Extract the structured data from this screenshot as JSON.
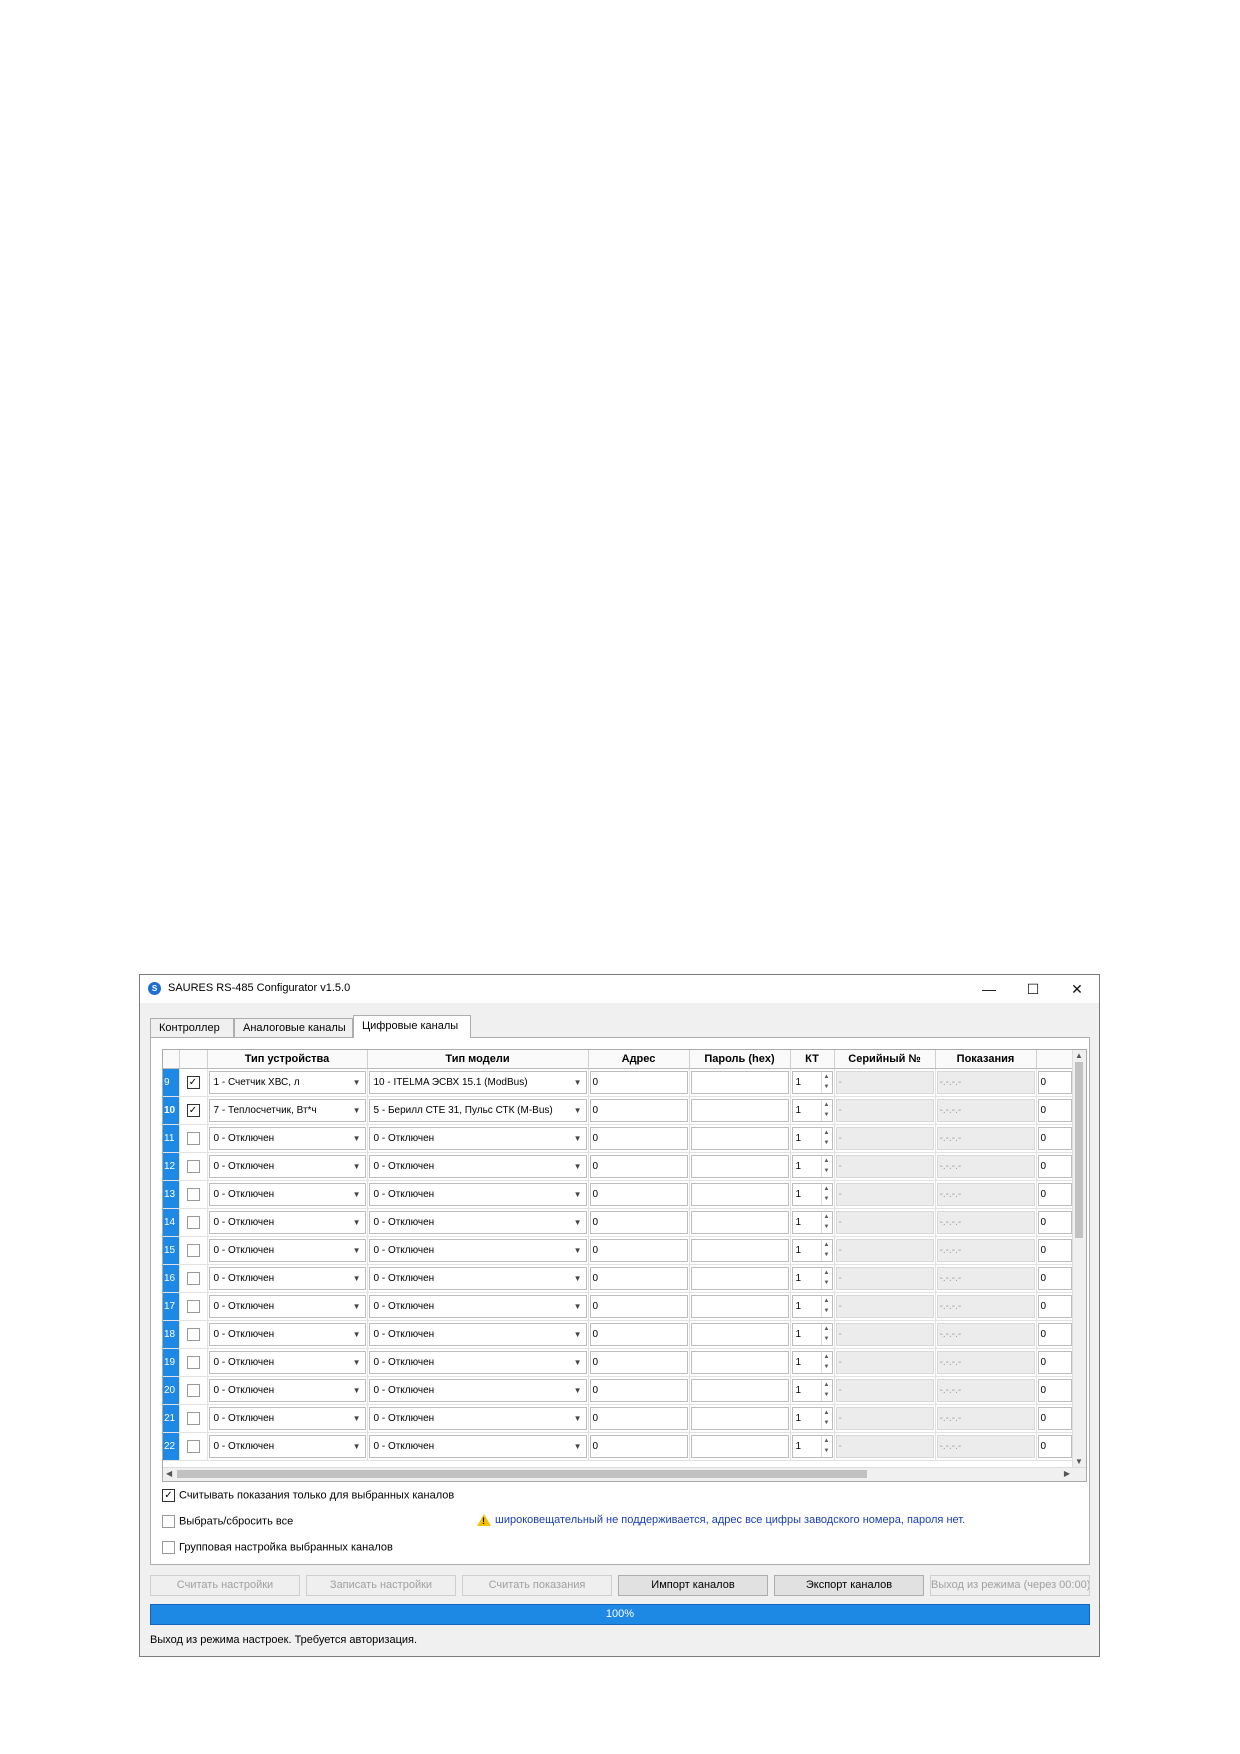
{
  "window": {
    "title": "SAURES RS-485 Configurator v1.5.0",
    "icon": "app-icon"
  },
  "window_controls": {
    "minimize": "—",
    "maximize": "☐",
    "close": "✕"
  },
  "tabs": [
    {
      "label": "Контроллер",
      "active": false
    },
    {
      "label": "Аналоговые каналы",
      "active": false
    },
    {
      "label": "Цифровые каналы",
      "active": true
    }
  ],
  "table": {
    "headers": [
      "",
      "",
      "Тип устройства",
      "Тип модели",
      "Адрес",
      "Пароль (hex)",
      "КТ",
      "Серийный №",
      "Показания",
      ""
    ],
    "rows": [
      {
        "num": "9",
        "checked": true,
        "device": "1 - Счетчик ХВС, л",
        "model": "10 - ITELMA ЭСВХ 15.1 (ModBus)",
        "address": "0",
        "password": "",
        "kt": "1",
        "serial": "-",
        "reading": "-.-.-.-",
        "extra": "0"
      },
      {
        "num": "10",
        "checked": true,
        "device": "7 - Теплосчетчик, Вт*ч",
        "model": "5 - Берилл СТЕ 31, Пульс СТК (M-Bus)",
        "address": "0",
        "password": "",
        "kt": "1",
        "serial": "-",
        "reading": "-.-.-.-",
        "extra": "0"
      },
      {
        "num": "11",
        "checked": false,
        "device": "0 - Отключен",
        "model": "0 - Отключен",
        "address": "0",
        "password": "",
        "kt": "1",
        "serial": "-",
        "reading": "-.-.-.-",
        "extra": "0"
      },
      {
        "num": "12",
        "checked": false,
        "device": "0 - Отключен",
        "model": "0 - Отключен",
        "address": "0",
        "password": "",
        "kt": "1",
        "serial": "-",
        "reading": "-.-.-.-",
        "extra": "0"
      },
      {
        "num": "13",
        "checked": false,
        "device": "0 - Отключен",
        "model": "0 - Отключен",
        "address": "0",
        "password": "",
        "kt": "1",
        "serial": "-",
        "reading": "-.-.-.-",
        "extra": "0"
      },
      {
        "num": "14",
        "checked": false,
        "device": "0 - Отключен",
        "model": "0 - Отключен",
        "address": "0",
        "password": "",
        "kt": "1",
        "serial": "-",
        "reading": "-.-.-.-",
        "extra": "0"
      },
      {
        "num": "15",
        "checked": false,
        "device": "0 - Отключен",
        "model": "0 - Отключен",
        "address": "0",
        "password": "",
        "kt": "1",
        "serial": "-",
        "reading": "-.-.-.-",
        "extra": "0"
      },
      {
        "num": "16",
        "checked": false,
        "device": "0 - Отключен",
        "model": "0 - Отключен",
        "address": "0",
        "password": "",
        "kt": "1",
        "serial": "-",
        "reading": "-.-.-.-",
        "extra": "0"
      },
      {
        "num": "17",
        "checked": false,
        "device": "0 - Отключен",
        "model": "0 - Отключен",
        "address": "0",
        "password": "",
        "kt": "1",
        "serial": "-",
        "reading": "-.-.-.-",
        "extra": "0"
      },
      {
        "num": "18",
        "checked": false,
        "device": "0 - Отключен",
        "model": "0 - Отключен",
        "address": "0",
        "password": "",
        "kt": "1",
        "serial": "-",
        "reading": "-.-.-.-",
        "extra": "0"
      },
      {
        "num": "19",
        "checked": false,
        "device": "0 - Отключен",
        "model": "0 - Отключен",
        "address": "0",
        "password": "",
        "kt": "1",
        "serial": "-",
        "reading": "-.-.-.-",
        "extra": "0"
      },
      {
        "num": "20",
        "checked": false,
        "device": "0 - Отключен",
        "model": "0 - Отключен",
        "address": "0",
        "password": "",
        "kt": "1",
        "serial": "-",
        "reading": "-.-.-.-",
        "extra": "0"
      },
      {
        "num": "21",
        "checked": false,
        "device": "0 - Отключен",
        "model": "0 - Отключен",
        "address": "0",
        "password": "",
        "kt": "1",
        "serial": "-",
        "reading": "-.-.-.-",
        "extra": "0"
      },
      {
        "num": "22",
        "checked": false,
        "device": "0 - Отключен",
        "model": "0 - Отключен",
        "address": "0",
        "password": "",
        "kt": "1",
        "serial": "-",
        "reading": "-.-.-.-",
        "extra": "0"
      }
    ]
  },
  "options": {
    "read_selected": {
      "label": "Считывать показания только для выбранных каналов",
      "checked": true
    },
    "select_all": {
      "label": "Выбрать/сбросить все",
      "checked": false
    },
    "group_setup": {
      "label": "Групповая настройка выбранных каналов",
      "checked": false
    }
  },
  "warning": {
    "icon": "warning-icon",
    "text": "широковещательный не поддерживается, адрес все цифры заводского номера, пароля нет."
  },
  "buttons": {
    "read_settings": "Считать настройки",
    "write_settings": "Записать настройки",
    "read_readings": "Считать показания",
    "import_channels": "Импорт каналов",
    "export_channels": "Экспорт каналов",
    "exit_mode": "Выход из режима (через 00:00)"
  },
  "progress": {
    "value": 100,
    "label": "100%"
  },
  "status": "Выход из режима настроек. Требуется авторизация.",
  "colors": {
    "accent": "#1e88e5",
    "warning_text": "#1a3fb0"
  }
}
